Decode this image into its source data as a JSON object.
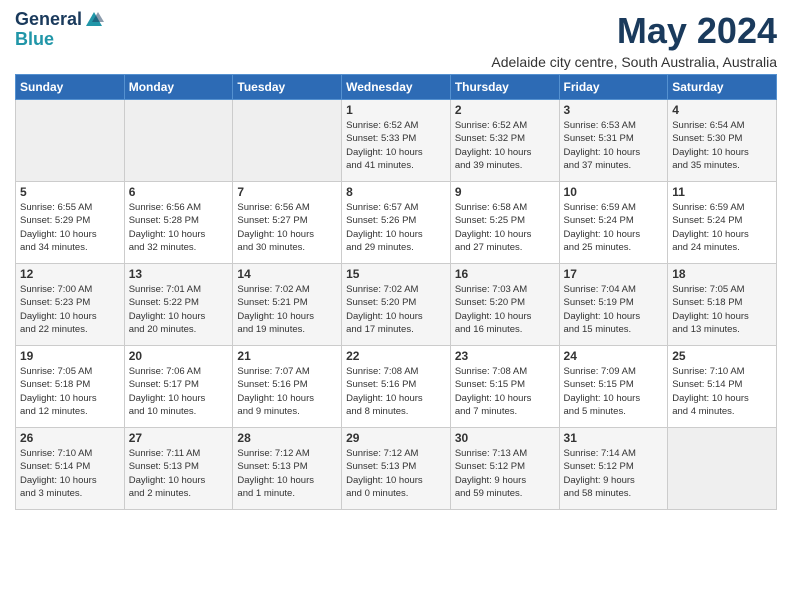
{
  "header": {
    "logo_line1": "General",
    "logo_line2": "Blue",
    "month": "May 2024",
    "location": "Adelaide city centre, South Australia, Australia"
  },
  "days_of_week": [
    "Sunday",
    "Monday",
    "Tuesday",
    "Wednesday",
    "Thursday",
    "Friday",
    "Saturday"
  ],
  "weeks": [
    [
      {
        "day": "",
        "info": ""
      },
      {
        "day": "",
        "info": ""
      },
      {
        "day": "",
        "info": ""
      },
      {
        "day": "1",
        "info": "Sunrise: 6:52 AM\nSunset: 5:33 PM\nDaylight: 10 hours\nand 41 minutes."
      },
      {
        "day": "2",
        "info": "Sunrise: 6:52 AM\nSunset: 5:32 PM\nDaylight: 10 hours\nand 39 minutes."
      },
      {
        "day": "3",
        "info": "Sunrise: 6:53 AM\nSunset: 5:31 PM\nDaylight: 10 hours\nand 37 minutes."
      },
      {
        "day": "4",
        "info": "Sunrise: 6:54 AM\nSunset: 5:30 PM\nDaylight: 10 hours\nand 35 minutes."
      }
    ],
    [
      {
        "day": "5",
        "info": "Sunrise: 6:55 AM\nSunset: 5:29 PM\nDaylight: 10 hours\nand 34 minutes."
      },
      {
        "day": "6",
        "info": "Sunrise: 6:56 AM\nSunset: 5:28 PM\nDaylight: 10 hours\nand 32 minutes."
      },
      {
        "day": "7",
        "info": "Sunrise: 6:56 AM\nSunset: 5:27 PM\nDaylight: 10 hours\nand 30 minutes."
      },
      {
        "day": "8",
        "info": "Sunrise: 6:57 AM\nSunset: 5:26 PM\nDaylight: 10 hours\nand 29 minutes."
      },
      {
        "day": "9",
        "info": "Sunrise: 6:58 AM\nSunset: 5:25 PM\nDaylight: 10 hours\nand 27 minutes."
      },
      {
        "day": "10",
        "info": "Sunrise: 6:59 AM\nSunset: 5:24 PM\nDaylight: 10 hours\nand 25 minutes."
      },
      {
        "day": "11",
        "info": "Sunrise: 6:59 AM\nSunset: 5:24 PM\nDaylight: 10 hours\nand 24 minutes."
      }
    ],
    [
      {
        "day": "12",
        "info": "Sunrise: 7:00 AM\nSunset: 5:23 PM\nDaylight: 10 hours\nand 22 minutes."
      },
      {
        "day": "13",
        "info": "Sunrise: 7:01 AM\nSunset: 5:22 PM\nDaylight: 10 hours\nand 20 minutes."
      },
      {
        "day": "14",
        "info": "Sunrise: 7:02 AM\nSunset: 5:21 PM\nDaylight: 10 hours\nand 19 minutes."
      },
      {
        "day": "15",
        "info": "Sunrise: 7:02 AM\nSunset: 5:20 PM\nDaylight: 10 hours\nand 17 minutes."
      },
      {
        "day": "16",
        "info": "Sunrise: 7:03 AM\nSunset: 5:20 PM\nDaylight: 10 hours\nand 16 minutes."
      },
      {
        "day": "17",
        "info": "Sunrise: 7:04 AM\nSunset: 5:19 PM\nDaylight: 10 hours\nand 15 minutes."
      },
      {
        "day": "18",
        "info": "Sunrise: 7:05 AM\nSunset: 5:18 PM\nDaylight: 10 hours\nand 13 minutes."
      }
    ],
    [
      {
        "day": "19",
        "info": "Sunrise: 7:05 AM\nSunset: 5:18 PM\nDaylight: 10 hours\nand 12 minutes."
      },
      {
        "day": "20",
        "info": "Sunrise: 7:06 AM\nSunset: 5:17 PM\nDaylight: 10 hours\nand 10 minutes."
      },
      {
        "day": "21",
        "info": "Sunrise: 7:07 AM\nSunset: 5:16 PM\nDaylight: 10 hours\nand 9 minutes."
      },
      {
        "day": "22",
        "info": "Sunrise: 7:08 AM\nSunset: 5:16 PM\nDaylight: 10 hours\nand 8 minutes."
      },
      {
        "day": "23",
        "info": "Sunrise: 7:08 AM\nSunset: 5:15 PM\nDaylight: 10 hours\nand 7 minutes."
      },
      {
        "day": "24",
        "info": "Sunrise: 7:09 AM\nSunset: 5:15 PM\nDaylight: 10 hours\nand 5 minutes."
      },
      {
        "day": "25",
        "info": "Sunrise: 7:10 AM\nSunset: 5:14 PM\nDaylight: 10 hours\nand 4 minutes."
      }
    ],
    [
      {
        "day": "26",
        "info": "Sunrise: 7:10 AM\nSunset: 5:14 PM\nDaylight: 10 hours\nand 3 minutes."
      },
      {
        "day": "27",
        "info": "Sunrise: 7:11 AM\nSunset: 5:13 PM\nDaylight: 10 hours\nand 2 minutes."
      },
      {
        "day": "28",
        "info": "Sunrise: 7:12 AM\nSunset: 5:13 PM\nDaylight: 10 hours\nand 1 minute."
      },
      {
        "day": "29",
        "info": "Sunrise: 7:12 AM\nSunset: 5:13 PM\nDaylight: 10 hours\nand 0 minutes."
      },
      {
        "day": "30",
        "info": "Sunrise: 7:13 AM\nSunset: 5:12 PM\nDaylight: 9 hours\nand 59 minutes."
      },
      {
        "day": "31",
        "info": "Sunrise: 7:14 AM\nSunset: 5:12 PM\nDaylight: 9 hours\nand 58 minutes."
      },
      {
        "day": "",
        "info": ""
      }
    ]
  ]
}
